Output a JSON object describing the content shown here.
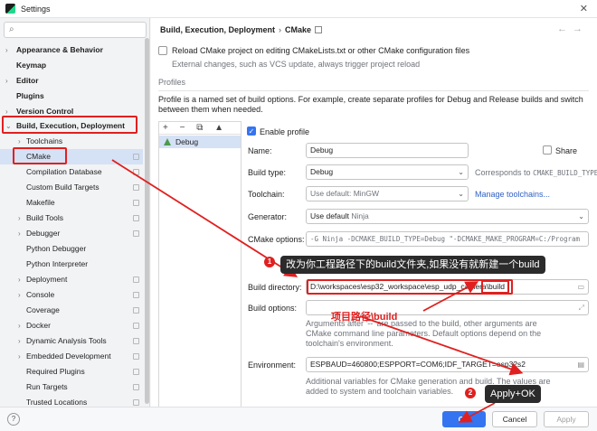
{
  "window": {
    "title": "Settings"
  },
  "sidebar": {
    "items": [
      {
        "label": "Appearance & Behavior",
        "bold": true,
        "arrow": "›"
      },
      {
        "label": "Keymap",
        "bold": true,
        "arrow": ""
      },
      {
        "label": "Editor",
        "bold": true,
        "arrow": "›"
      },
      {
        "label": "Plugins",
        "bold": true,
        "arrow": ""
      },
      {
        "label": "Version Control",
        "bold": true,
        "arrow": "›"
      },
      {
        "label": "Build, Execution, Deployment",
        "bold": true,
        "arrow": "⌄"
      },
      {
        "label": "Toolchains",
        "arrow": "›"
      },
      {
        "label": "CMake",
        "arrow": ""
      },
      {
        "label": "Compilation Database",
        "arrow": ""
      },
      {
        "label": "Custom Build Targets",
        "arrow": ""
      },
      {
        "label": "Makefile",
        "arrow": ""
      },
      {
        "label": "Build Tools",
        "arrow": "›"
      },
      {
        "label": "Debugger",
        "arrow": "›"
      },
      {
        "label": "Python Debugger",
        "arrow": ""
      },
      {
        "label": "Python Interpreter",
        "arrow": ""
      },
      {
        "label": "Deployment",
        "arrow": "›"
      },
      {
        "label": "Console",
        "arrow": "›"
      },
      {
        "label": "Coverage",
        "arrow": ""
      },
      {
        "label": "Docker",
        "arrow": "›"
      },
      {
        "label": "Dynamic Analysis Tools",
        "arrow": "›"
      },
      {
        "label": "Embedded Development",
        "arrow": "›"
      },
      {
        "label": "Required Plugins",
        "arrow": ""
      },
      {
        "label": "Run Targets",
        "arrow": ""
      },
      {
        "label": "Trusted Locations",
        "arrow": ""
      }
    ]
  },
  "breadcrumb": {
    "parent": "Build, Execution, Deployment",
    "sep": "›",
    "current": "CMake"
  },
  "reload": {
    "label": "Reload CMake project on editing CMakeLists.txt or other CMake configuration files",
    "hint": "External changes, such as VCS update, always trigger project reload"
  },
  "profiles": {
    "heading": "Profiles",
    "description_line1": "Profile is a named set of build options. For example, create separate profiles for Debug and Release builds and switch",
    "description_line2": "between them when needed.",
    "toolbar": "+ − ⧉ ▲ ▼",
    "items": [
      "Debug"
    ]
  },
  "form": {
    "enable_profile": "Enable profile",
    "name_label": "Name:",
    "name_value": "Debug",
    "share_label": "Share",
    "build_type_label": "Build type:",
    "build_type_value": "Debug",
    "corresponds_label": "Corresponds to",
    "corresponds_value": "CMAKE_BUILD_TYPE",
    "toolchain_label": "Toolchain:",
    "toolchain_value": "Use default: MinGW",
    "manage_toolchains": "Manage toolchains...",
    "generator_label": "Generator:",
    "generator_value": "Use default",
    "generator_hint": "Ninja",
    "cmake_options_label": "CMake options:",
    "cmake_options_value": "-G Ninja -DCMAKE_BUILD_TYPE=Debug \"-DCMAKE_MAKE_PROGRAM=C:/Program",
    "build_directory_label": "Build directory:",
    "build_directory_value": "D:\\workspaces\\esp32_workspace\\esp_udp_camera\\build",
    "build_options_label": "Build options:",
    "build_options_hint_line1": "Arguments after '--' are passed to the build, other arguments are",
    "build_options_hint_line2": "CMake command line parameters. Default options depend on the",
    "build_options_hint_line3": "toolchain's environment.",
    "environment_label": "Environment:",
    "environment_value": "ESPBAUD=460800;ESPPORT=COM6;IDF_TARGET=esp32s2",
    "environment_hint_line1": "Additional variables for CMake generation and build. The values are",
    "environment_hint_line2": "added to system and toolchain variables."
  },
  "buttons": {
    "help": "?",
    "ok": "OK",
    "cancel": "Cancel",
    "apply": "Apply"
  },
  "annotations": {
    "badge1": "1",
    "callout1": "改为你工程路径下的build文件夹,如果没有就新建一个build",
    "label_path": "项目路径\\build",
    "badge2": "2",
    "callout2": "Apply+OK",
    "color": "#e02020"
  }
}
